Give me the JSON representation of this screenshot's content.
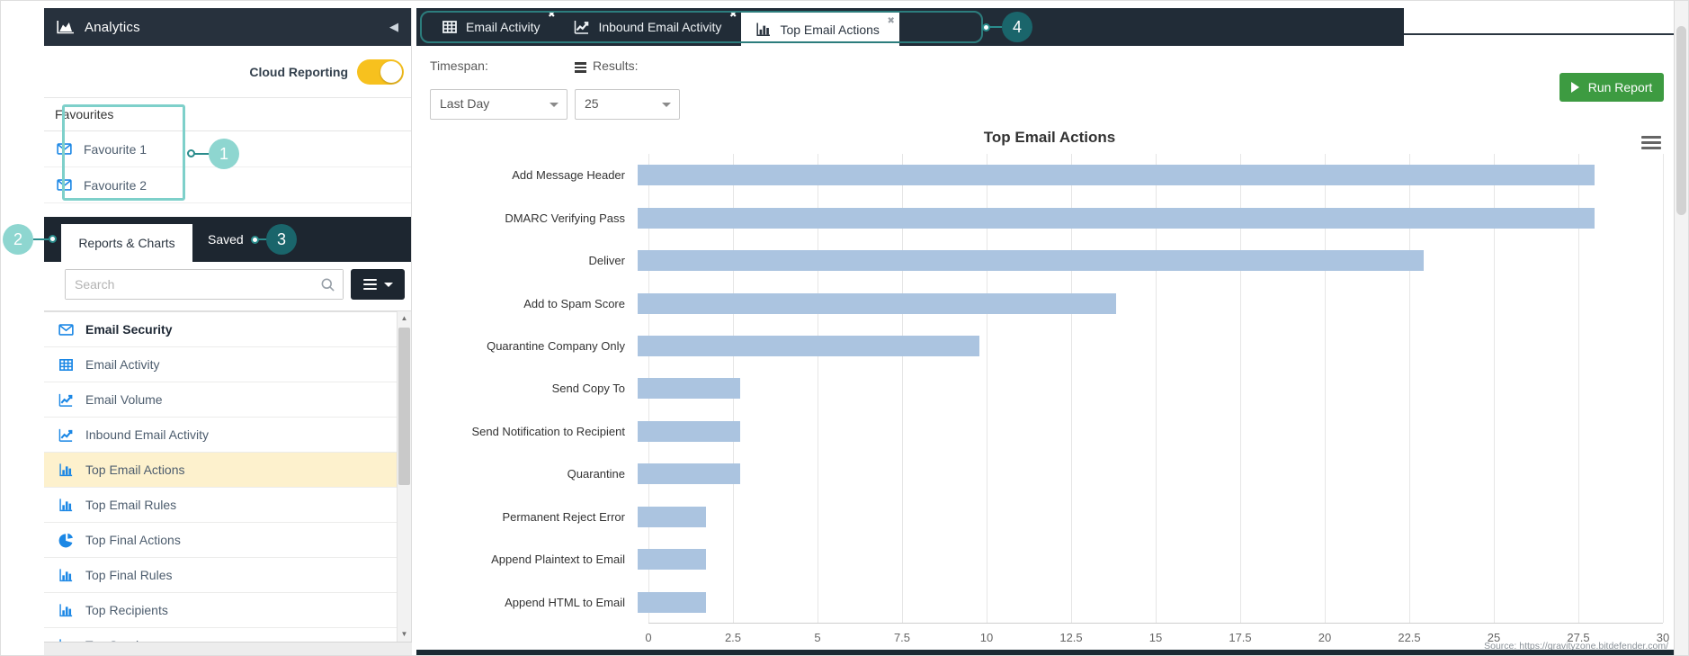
{
  "sidebar": {
    "title": "Analytics",
    "collapse_arrow": "◀",
    "cloud_reporting": {
      "label": "Cloud Reporting",
      "state": "on"
    },
    "favourites": {
      "header": "Favourites",
      "items": [
        {
          "label": "Favourite 1",
          "icon": "envelope"
        },
        {
          "label": "Favourite 2",
          "icon": "envelope"
        }
      ]
    },
    "tabs": {
      "reports": "Reports & Charts",
      "saved": "Saved"
    },
    "search": {
      "placeholder": "Search"
    },
    "reports": [
      {
        "label": "Email Security",
        "icon": "envelope",
        "bold": true
      },
      {
        "label": "Email Activity",
        "icon": "table"
      },
      {
        "label": "Email Volume",
        "icon": "line-chart"
      },
      {
        "label": "Inbound Email Activity",
        "icon": "line-chart"
      },
      {
        "label": "Top Email Actions",
        "icon": "bar-chart",
        "selected": true
      },
      {
        "label": "Top Email Rules",
        "icon": "bar-chart"
      },
      {
        "label": "Top Final Actions",
        "icon": "pie-chart"
      },
      {
        "label": "Top Final Rules",
        "icon": "bar-chart"
      },
      {
        "label": "Top Recipients",
        "icon": "bar-chart"
      },
      {
        "label": "Top Senders",
        "icon": "bar-chart"
      }
    ],
    "scrollbar": {
      "up": "▲",
      "down": "▼"
    }
  },
  "workspace": {
    "close_glyph": "✖",
    "tabs": [
      {
        "label": "Email Activity",
        "icon": "table",
        "active": false
      },
      {
        "label": "Inbound Email Activity",
        "icon": "line-chart",
        "active": false
      },
      {
        "label": "Top Email Actions",
        "icon": "bar-chart",
        "active": true
      }
    ]
  },
  "toolbar": {
    "timespan_label": "Timespan:",
    "timespan_value": "Last Day",
    "results_label": "Results:",
    "results_value": "25",
    "run_report": "Run Report"
  },
  "callouts": {
    "one": "1",
    "two": "2",
    "three": "3",
    "four": "4"
  },
  "chart_data": {
    "type": "bar",
    "orientation": "horizontal",
    "title": "Top Email Actions",
    "categories": [
      "Add Message Header",
      "DMARC Verifying Pass",
      "Deliver",
      "Add to Spam Score",
      "Quarantine Company Only",
      "Send Copy To",
      "Send Notification to Recipient",
      "Quarantine",
      "Permanent Reject Error",
      "Append Plaintext to Email",
      "Append HTML to Email"
    ],
    "values": [
      28,
      28,
      23,
      14,
      10,
      3,
      3,
      3,
      2,
      2,
      2
    ],
    "xlim": [
      0,
      30
    ],
    "xticks": [
      0,
      2.5,
      5,
      7.5,
      10,
      12.5,
      15,
      17.5,
      20,
      22.5,
      25,
      27.5,
      30
    ],
    "xtick_labels": [
      "0",
      "2.5",
      "5",
      "7.5",
      "10",
      "12.5",
      "15",
      "17.5",
      "20",
      "22.5",
      "25",
      "27.5",
      "30"
    ],
    "grid": true,
    "legend": false,
    "bar_color": "#abc4e0",
    "source": "Source: https://gravityzone.bitdefender.com/"
  },
  "colors": {
    "header_dark": "#27313d",
    "accent_teal": "#2a8c8c",
    "callout_light": "#8ed6d0",
    "callout_dark": "#1a656b",
    "toggle_yellow": "#f7c11e",
    "selected_row": "#fdf1cd",
    "icon_blue": "#1b87e5",
    "run_green": "#3d9b41",
    "bar_blue": "#abc4e0"
  }
}
